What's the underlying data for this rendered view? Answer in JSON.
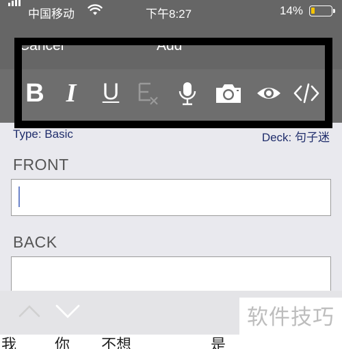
{
  "status_bar": {
    "carrier": "中国移动",
    "time": "下午8:27",
    "battery": "14%"
  },
  "nav": {
    "cancel_label": "Cancel",
    "title": "Add"
  },
  "toolbar": {
    "bold_label": "B",
    "italic_label": "I",
    "underline_label": "U",
    "clear_format_icon": "clear-formatting-icon",
    "record_icon": "microphone-icon",
    "camera_icon": "camera-icon",
    "preview_icon": "eye-icon",
    "html_icon": "code-icon"
  },
  "note": {
    "type_label": "Type: Basic",
    "deck_label": "Deck: 句子迷"
  },
  "fields": [
    {
      "label": "FRONT",
      "value": ""
    },
    {
      "label": "BACK",
      "value": ""
    }
  ],
  "suggestions": [
    "我",
    "你",
    "不想",
    "是"
  ],
  "watermark": "软件技巧",
  "colors": {
    "bar": "#666666",
    "toolbar": "#6e6e6e",
    "highlight": "#000000",
    "link": "#1f2d6b",
    "battery_low": "#f5c400"
  }
}
